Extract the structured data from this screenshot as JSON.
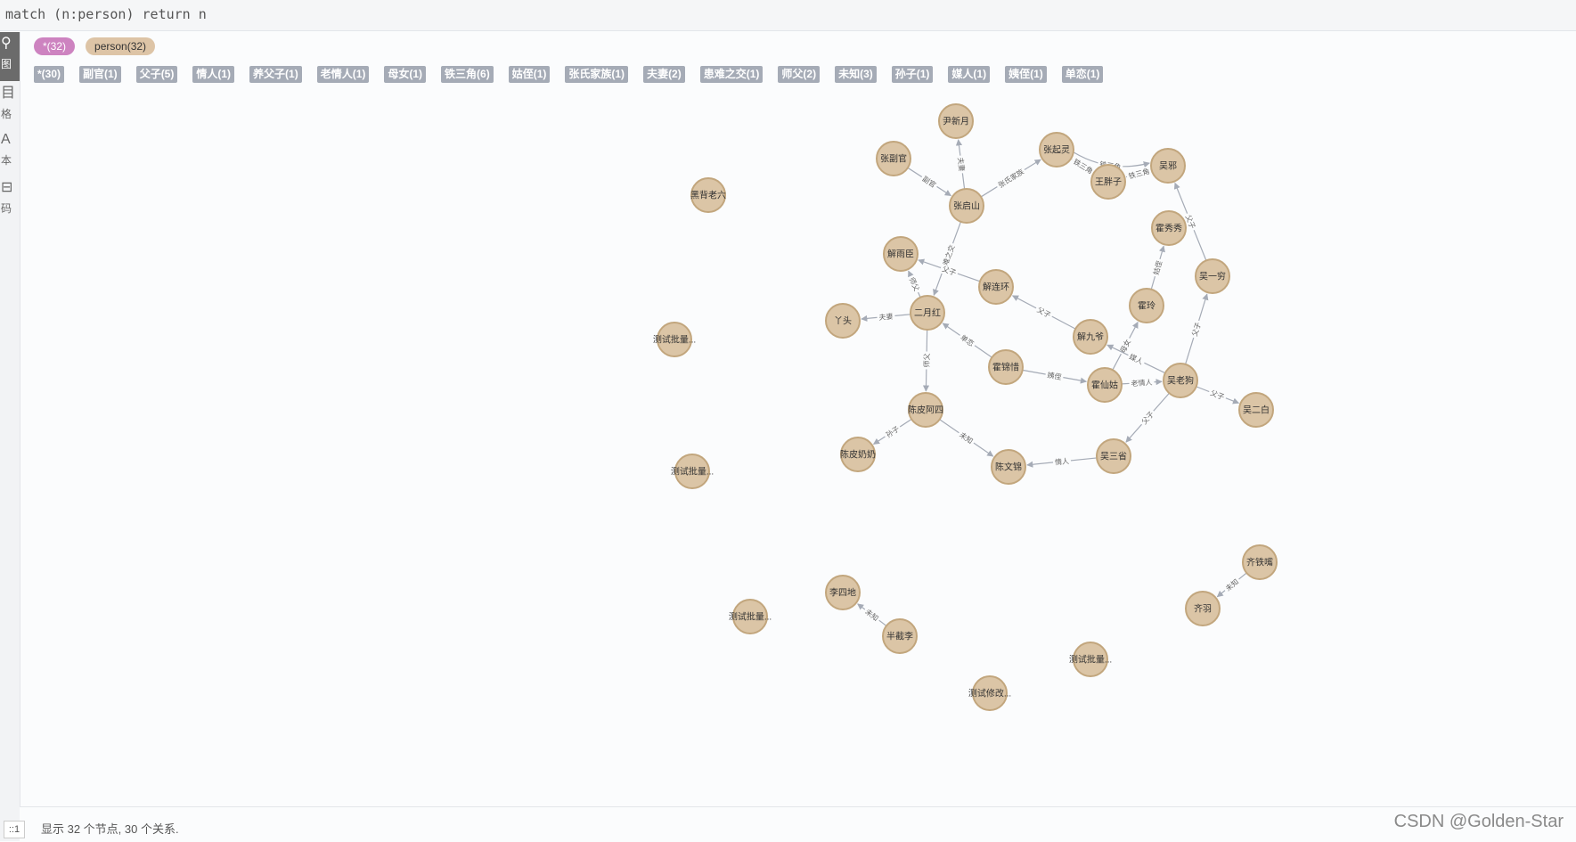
{
  "query": "match (n:person) return n",
  "rail": [
    {
      "icon": "graph-icon",
      "label": "图"
    },
    {
      "icon": "table-icon",
      "label": "格"
    },
    {
      "icon": "text-icon",
      "label": "本"
    },
    {
      "icon": "code-icon",
      "label": "码"
    }
  ],
  "labels": [
    {
      "text": "*(32)",
      "kind": "all"
    },
    {
      "text": "person(32)",
      "kind": "person"
    }
  ],
  "relationship_types": [
    "*(30)",
    "副官(1)",
    "父子(5)",
    "情人(1)",
    "养父子(1)",
    "老情人(1)",
    "母女(1)",
    "铁三角(6)",
    "姑侄(1)",
    "张氏家族(1)",
    "夫妻(2)",
    "患难之交(1)",
    "师父(2)",
    "未知(3)",
    "孙子(1)",
    "媒人(1)",
    "姨侄(1)",
    "单恋(1)"
  ],
  "graph": {
    "node_color": "#dbc5a6",
    "node_stroke": "#c2a67d",
    "edge_color": "#a5abb6",
    "nodes": [
      {
        "id": "n1",
        "label": "尹新月"
      },
      {
        "id": "n2",
        "label": "张副官"
      },
      {
        "id": "n3",
        "label": "张起灵"
      },
      {
        "id": "n4",
        "label": "吴邪"
      },
      {
        "id": "n5",
        "label": "王胖子"
      },
      {
        "id": "n6",
        "label": "黑背老六"
      },
      {
        "id": "n7",
        "label": "张启山"
      },
      {
        "id": "n8",
        "label": "霍秀秀"
      },
      {
        "id": "n9",
        "label": "解雨臣"
      },
      {
        "id": "n10",
        "label": "吴一穷"
      },
      {
        "id": "n11",
        "label": "解连环"
      },
      {
        "id": "n12",
        "label": "霍玲"
      },
      {
        "id": "n13",
        "label": "二月红"
      },
      {
        "id": "n14",
        "label": "丫头"
      },
      {
        "id": "n15",
        "label": "测试批量..."
      },
      {
        "id": "n16",
        "label": "解九爷"
      },
      {
        "id": "n17",
        "label": "霍锦惜"
      },
      {
        "id": "n18",
        "label": "霍仙姑"
      },
      {
        "id": "n19",
        "label": "吴老狗"
      },
      {
        "id": "n20",
        "label": "吴二白"
      },
      {
        "id": "n21",
        "label": "陈皮阿四"
      },
      {
        "id": "n22",
        "label": "测试批量..."
      },
      {
        "id": "n23",
        "label": "陈皮奶奶"
      },
      {
        "id": "n24",
        "label": "陈文锦"
      },
      {
        "id": "n25",
        "label": "吴三省"
      },
      {
        "id": "n26",
        "label": "齐铁嘴"
      },
      {
        "id": "n27",
        "label": "齐羽"
      },
      {
        "id": "n28",
        "label": "李四地"
      },
      {
        "id": "n29",
        "label": "测试批量..."
      },
      {
        "id": "n30",
        "label": "半截李"
      },
      {
        "id": "n31",
        "label": "测试批量..."
      },
      {
        "id": "n32",
        "label": "测试修改..."
      }
    ],
    "edges": [
      {
        "from": "n2",
        "to": "n7",
        "label": "副官"
      },
      {
        "from": "n7",
        "to": "n1",
        "label": "夫妻"
      },
      {
        "from": "n7",
        "to": "n3",
        "label": "张氏家族"
      },
      {
        "from": "n3",
        "to": "n4",
        "label": "铁三角",
        "curve": true
      },
      {
        "from": "n3",
        "to": "n5",
        "label": "铁三角"
      },
      {
        "from": "n5",
        "to": "n3",
        "label": "铁三角"
      },
      {
        "from": "n5",
        "to": "n4",
        "label": "铁三角"
      },
      {
        "from": "n4",
        "to": "n5",
        "label": "铁三角"
      },
      {
        "from": "n7",
        "to": "n13",
        "label": "患难之交"
      },
      {
        "from": "n13",
        "to": "n9",
        "label": "师父"
      },
      {
        "from": "n11",
        "to": "n9",
        "label": "父子"
      },
      {
        "from": "n13",
        "to": "n14",
        "label": "夫妻"
      },
      {
        "from": "n13",
        "to": "n21",
        "label": "师父"
      },
      {
        "from": "n17",
        "to": "n13",
        "label": "单恋"
      },
      {
        "from": "n16",
        "to": "n11",
        "label": "父子"
      },
      {
        "from": "n17",
        "to": "n18",
        "label": "姨侄"
      },
      {
        "from": "n18",
        "to": "n12",
        "label": "母女"
      },
      {
        "from": "n12",
        "to": "n8",
        "label": "姑侄"
      },
      {
        "from": "n10",
        "to": "n4",
        "label": "父子"
      },
      {
        "from": "n19",
        "to": "n10",
        "label": "父子"
      },
      {
        "from": "n19",
        "to": "n16",
        "label": "媒人"
      },
      {
        "from": "n18",
        "to": "n19",
        "label": "老情人"
      },
      {
        "from": "n19",
        "to": "n20",
        "label": "父子"
      },
      {
        "from": "n19",
        "to": "n25",
        "label": "父子"
      },
      {
        "from": "n25",
        "to": "n24",
        "label": "情人"
      },
      {
        "from": "n21",
        "to": "n23",
        "label": "孙子"
      },
      {
        "from": "n21",
        "to": "n24",
        "label": "未知"
      },
      {
        "from": "n26",
        "to": "n27",
        "label": "未知"
      },
      {
        "from": "n30",
        "to": "n28",
        "label": "未知"
      }
    ]
  },
  "status": "显示 32 个节点, 30 个关系.",
  "zoom_label": "::1",
  "watermark": "CSDN @Golden-Star"
}
